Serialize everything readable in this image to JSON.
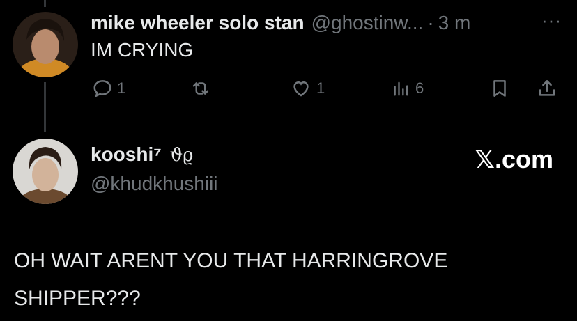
{
  "tweet": {
    "display_name": "mike wheeler solo stan",
    "handle": "@ghostinw...",
    "separator": "·",
    "time": "3 m",
    "more": "···",
    "text": "IM CRYING",
    "actions": {
      "reply_count": "1",
      "like_count": "1",
      "views_count": "6"
    }
  },
  "reply": {
    "display_name": "kooshi⁷ ꒰ᐢ. .ᐢ꒱",
    "display_name_main": "kooshi⁷",
    "display_name_glyph": "ϑϱ",
    "handle": "@khudkhushiii",
    "source": "𝕏.com",
    "text": "OH WAIT ARENT YOU THAT HARRINGROVE SHIPPER???"
  },
  "colors": {
    "background": "#000000",
    "primary_text": "#e7e9ea",
    "secondary_text": "#71767b",
    "thread_line": "#333639"
  },
  "icons": [
    "reply-icon",
    "retweet-icon",
    "like-icon",
    "views-icon",
    "bookmark-icon",
    "share-icon",
    "more-icon"
  ]
}
